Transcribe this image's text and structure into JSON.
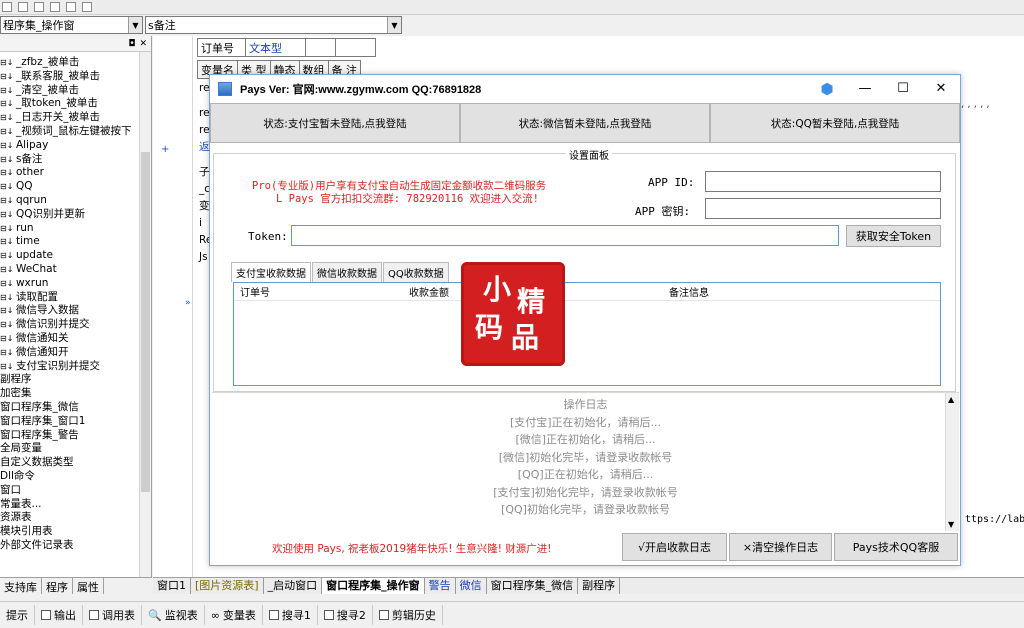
{
  "toolbar": {
    "icons": [
      "align-icon",
      "format-icon",
      "grid-icon",
      "table-icon",
      "layout-icon",
      "window-icon"
    ]
  },
  "combo_left": {
    "value": "程序集_操作窗"
  },
  "combo_right": {
    "value": "s备注"
  },
  "tree_items": [
    "_zfbz_被单击",
    "_联系客服_被单击",
    "_清空_被单击",
    "_取token_被单击",
    "_日志开关_被单击",
    "_视频词_鼠标左键被按下",
    "Alipay",
    "s备注",
    "other",
    "QQ",
    "qqrun",
    "QQ识别并更新",
    "run",
    "time",
    "update",
    "WeChat",
    "wxrun",
    "读取配置",
    "微信导入数据",
    "微信识别并提交",
    "微信通知关",
    "微信通知开",
    "支付宝识别并提交",
    "副程序",
    "加密集",
    "窗口程序集_微信",
    "窗口程序集_窗口1",
    "窗口程序集_警告",
    "全局变量",
    "自定义数据类型",
    "Dll命令",
    "窗口",
    "常量表...",
    "资源表",
    "模块引用表",
    "外部文件记录表"
  ],
  "left_tabs": [
    "支持库",
    "程序",
    "属性"
  ],
  "code": {
    "header_row": [
      "订单号",
      "文本型",
      "",
      ""
    ],
    "var_header": [
      "变量名",
      "类 型",
      "静态",
      "数组",
      "备 注"
    ],
    "side_labels": [
      "re",
      "re",
      "re",
      "返回",
      "子",
      "_c",
      "变",
      "i",
      "Re",
      "Js"
    ],
    "url_fragment": "ttps://lab.",
    "commas": ", , , , ,"
  },
  "doc_tabs": [
    "窗口1",
    "[图片资源表]",
    "_启动窗口",
    "窗口程序集_操作窗",
    "警告",
    "微信",
    "窗口程序集_微信",
    "副程序"
  ],
  "status_bar": [
    "提示",
    "输出",
    "调用表",
    "监视表",
    "变量表",
    "搜寻1",
    "搜寻2",
    "剪辑历史"
  ],
  "dialog": {
    "title": "Pays Ver:  官网:www.zgymw.com QQ:76891828",
    "status_buttons": [
      "状态:支付宝暂未登陆,点我登陆",
      "状态:微信暂未登陆,点我登陆",
      "状态:QQ暂未登陆,点我登陆"
    ],
    "settings_legend": "设置面板",
    "promo_line1": "Pro(专业版)用户享有支付宝自动生成固定金额收款二维码服务",
    "promo_line2": "L Pays 官方扣扣交流群: 782920116 欢迎进入交流!",
    "app_id_label": "APP ID:",
    "app_key_label": "APP 密钥:",
    "token_label": "Token:",
    "token_button": "获取安全Token",
    "tabs": [
      "支付宝收款数据",
      "微信收款数据",
      "QQ收款数据"
    ],
    "list_columns": [
      "订单号",
      "收款金额",
      "备注信息"
    ],
    "log_title": "操作日志",
    "log_lines": [
      "[支付宝]正在初始化，请稍后...",
      "[微信]正在初始化，请稍后...",
      "[微信]初始化完毕，请登录收款帐号",
      "[QQ]正在初始化，请稍后...",
      "[支付宝]初始化完毕，请登录收款帐号",
      "[QQ]初始化完毕，请登录收款帐号"
    ],
    "footer_text": "欢迎使用 Pays, 祝老板2019猪年快乐! 生意兴隆! 财源广进!",
    "btn_log": "√开启收款日志",
    "btn_clear": "×清空操作日志",
    "btn_support": "Pays技术QQ客服"
  },
  "stamp": {
    "chars": [
      "小",
      "精",
      "码",
      "品"
    ]
  },
  "colors": {
    "accent": "#5b9bd5",
    "promo_red": "#e02020",
    "stamp_red": "#d31f1f"
  }
}
